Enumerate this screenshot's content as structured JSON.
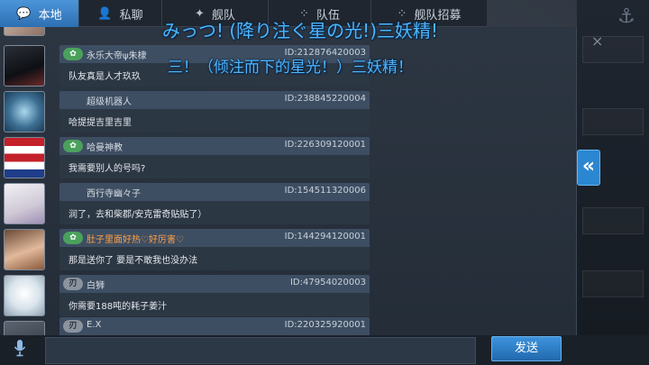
{
  "tabs": [
    {
      "label": "本地",
      "icon": "chat-bubbles-icon",
      "active": true
    },
    {
      "label": "私聊",
      "icon": "person-chat-icon",
      "active": false
    },
    {
      "label": "舰队",
      "icon": "fleet-icon",
      "active": false
    },
    {
      "label": "队伍",
      "icon": "team-icon",
      "active": false
    },
    {
      "label": "舰队招募",
      "icon": "recruit-icon",
      "active": false
    }
  ],
  "subtitles": {
    "japanese": "みっつ! (降り注ぐ星の光!)三妖精!",
    "chinese": "三！（倾注而下的星光！）三妖精！"
  },
  "messages": [
    {
      "name": "永乐大帝ψ朱棣",
      "id": "ID:212876420003",
      "text": "队友真是人才玖玖",
      "badge": "vip"
    },
    {
      "name": "超级机器人",
      "id": "ID:238845220004",
      "text": "哈提提吉里吉里",
      "badge": ""
    },
    {
      "name": "哈曼神教",
      "id": "ID:226309120001",
      "text": "我需要别人的号吗?",
      "badge": "vip"
    },
    {
      "name": "西行寺幽々子",
      "id": "ID:154511320006",
      "text": "润了，去和柴郡/安克雷奇贴贴了）",
      "badge": ""
    },
    {
      "name": "肚子里面好热♡好厉害♡",
      "id": "ID:144294120001",
      "text": "那是送你了 要是不敢我也没办法",
      "badge": "vip"
    },
    {
      "name": "白狮",
      "id": "ID:47954020003",
      "text": "你需要188吨的耗子姜汁",
      "badge": "rank"
    },
    {
      "name": "E.X",
      "id": "ID:220325920001",
      "text": "",
      "badge": "rank"
    }
  ],
  "input": {
    "placeholder": "",
    "value": ""
  },
  "send_label": "发送",
  "colors": {
    "accent": "#2d7fc8",
    "subtitle": "#4cb6ff",
    "vip_badge": "#4aa15c",
    "highlight_name": "#ff9f46"
  }
}
